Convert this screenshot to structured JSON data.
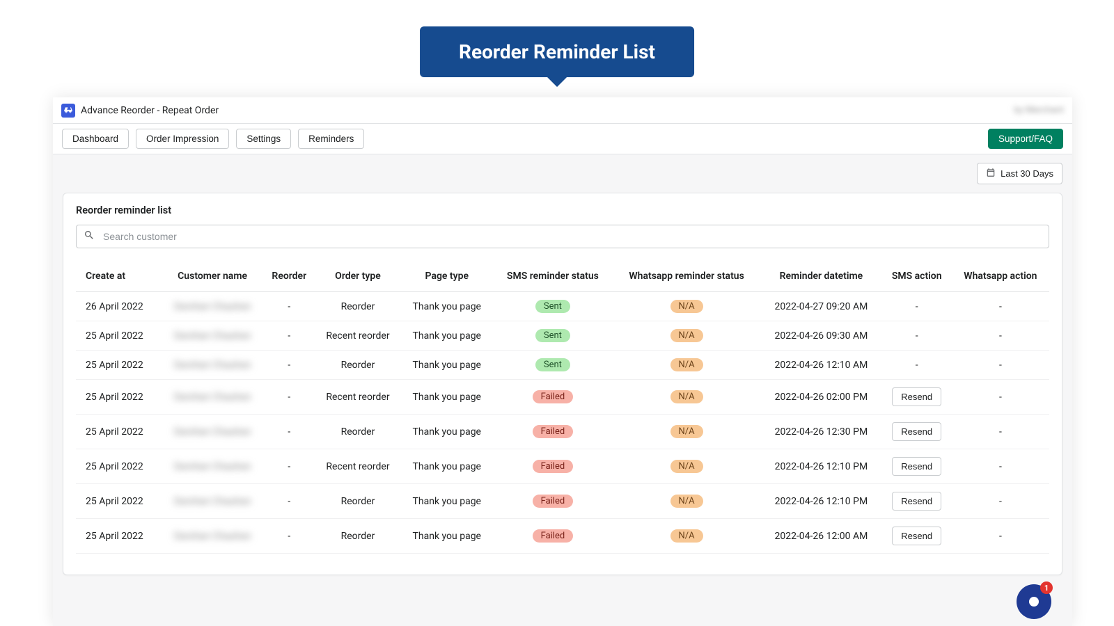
{
  "callout": "Reorder Reminder List",
  "app_title": "Advance Reorder - Repeat Order",
  "top_right_blur": "by Merchant",
  "nav": {
    "dashboard": "Dashboard",
    "order_impression": "Order Impression",
    "settings": "Settings",
    "reminders": "Reminders",
    "support": "Support/FAQ"
  },
  "date_filter": "Last 30 Days",
  "card_title": "Reorder reminder list",
  "search_placeholder": "Search customer",
  "columns": {
    "create_at": "Create at",
    "customer_name": "Customer name",
    "reorder": "Reorder",
    "order_type": "Order type",
    "page_type": "Page type",
    "sms_status": "SMS reminder status",
    "whatsapp_status": "Whatsapp reminder status",
    "reminder_dt": "Reminder datetime",
    "sms_action": "SMS action",
    "whatsapp_action": "Whatsapp action"
  },
  "badges": {
    "sent": "Sent",
    "failed": "Failed",
    "na": "N/A"
  },
  "resend_label": "Resend",
  "dash": "-",
  "blurred_name": "Darshan Chauhan",
  "rows": [
    {
      "create_at": "26 April 2022",
      "order_type": "Reorder",
      "page_type": "Thank you page",
      "sms": "sent",
      "wa": "na",
      "dt": "2022-04-27 09:20 AM",
      "sms_action": "-",
      "wa_action": "-"
    },
    {
      "create_at": "25 April 2022",
      "order_type": "Recent reorder",
      "page_type": "Thank you page",
      "sms": "sent",
      "wa": "na",
      "dt": "2022-04-26 09:30 AM",
      "sms_action": "-",
      "wa_action": "-"
    },
    {
      "create_at": "25 April 2022",
      "order_type": "Reorder",
      "page_type": "Thank you page",
      "sms": "sent",
      "wa": "na",
      "dt": "2022-04-26 12:10 AM",
      "sms_action": "-",
      "wa_action": "-"
    },
    {
      "create_at": "25 April 2022",
      "order_type": "Recent reorder",
      "page_type": "Thank you page",
      "sms": "failed",
      "wa": "na",
      "dt": "2022-04-26 02:00 PM",
      "sms_action": "resend",
      "wa_action": "-"
    },
    {
      "create_at": "25 April 2022",
      "order_type": "Reorder",
      "page_type": "Thank you page",
      "sms": "failed",
      "wa": "na",
      "dt": "2022-04-26 12:30 PM",
      "sms_action": "resend",
      "wa_action": "-"
    },
    {
      "create_at": "25 April 2022",
      "order_type": "Recent reorder",
      "page_type": "Thank you page",
      "sms": "failed",
      "wa": "na",
      "dt": "2022-04-26 12:10 PM",
      "sms_action": "resend",
      "wa_action": "-"
    },
    {
      "create_at": "25 April 2022",
      "order_type": "Reorder",
      "page_type": "Thank you page",
      "sms": "failed",
      "wa": "na",
      "dt": "2022-04-26 12:10 PM",
      "sms_action": "resend",
      "wa_action": "-"
    },
    {
      "create_at": "25 April 2022",
      "order_type": "Reorder",
      "page_type": "Thank you page",
      "sms": "failed",
      "wa": "na",
      "dt": "2022-04-26 12:00 AM",
      "sms_action": "resend",
      "wa_action": "-"
    }
  ],
  "chat_badge": "1"
}
